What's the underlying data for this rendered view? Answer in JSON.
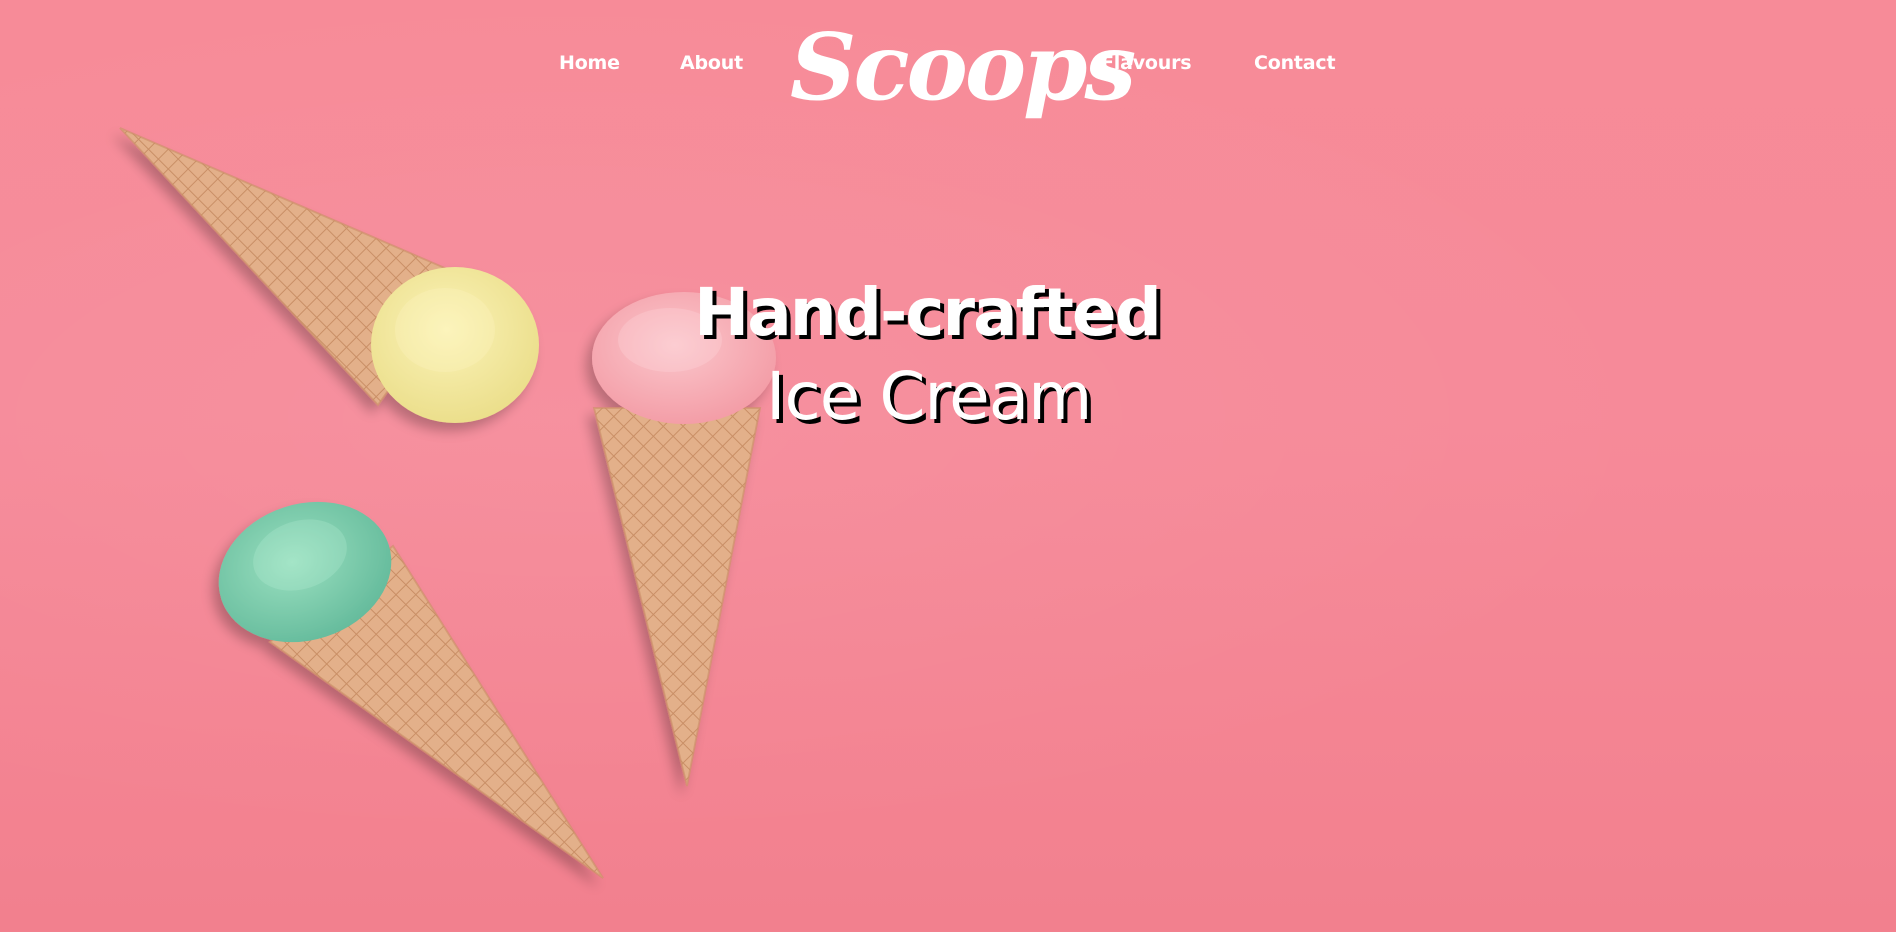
{
  "nav": {
    "items": [
      {
        "label": "Home"
      },
      {
        "label": "About"
      },
      {
        "label": "Flavours"
      },
      {
        "label": "Contact"
      }
    ],
    "logo_text": "Scoops"
  },
  "hero": {
    "headline_line1": "Hand-crafted",
    "headline_line2": "Ice Cream",
    "image_description_icons": [
      "ice-cream-cone-yellow",
      "ice-cream-cone-pink",
      "ice-cream-cone-green"
    ]
  },
  "colors": {
    "background": "#f58a99",
    "text": "#ffffff",
    "headline_shadow": "#000000",
    "cone": "#e3b08a",
    "scoop_yellow": "#f2e69a",
    "scoop_pink": "#f7aeb6",
    "scoop_green": "#7fcfae"
  }
}
